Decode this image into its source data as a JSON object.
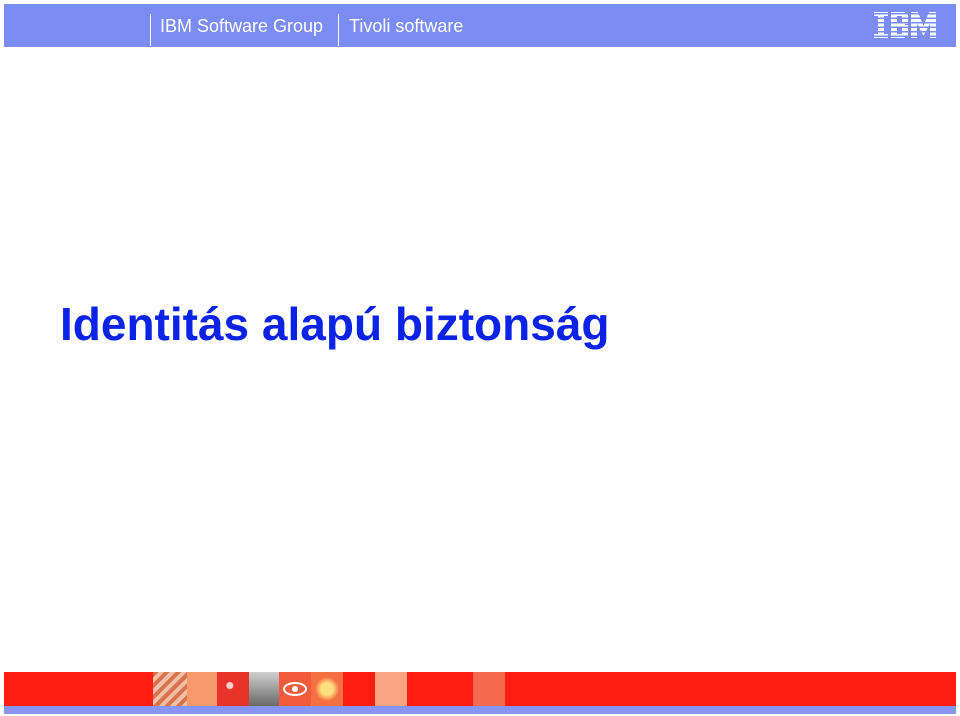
{
  "header": {
    "group": "IBM Software Group",
    "product": "Tivoli software",
    "logo_text": "IBM",
    "bar_color": "#7b8cf5",
    "text_color": "#ffffff"
  },
  "slide": {
    "title": "Identitás alapú biztonság",
    "title_color": "#0b23e6"
  },
  "footer": {
    "strip_color": "#fe1d10",
    "bottom_bar_color": "#8894f2"
  }
}
